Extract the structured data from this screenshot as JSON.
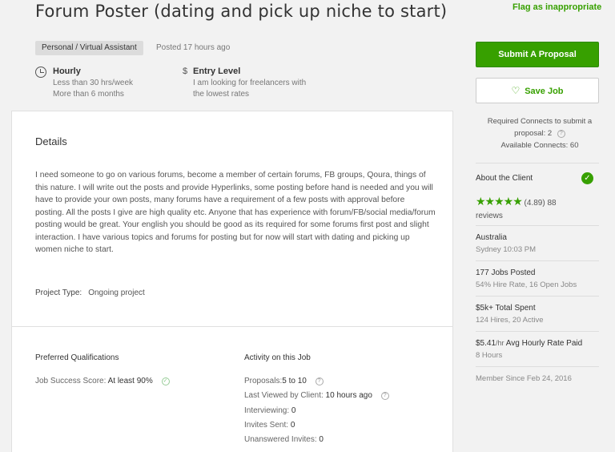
{
  "job": {
    "title": "Forum Poster (dating and pick up niche to start)",
    "flag_label": "Flag as inappropriate",
    "category": "Personal / Virtual Assistant",
    "posted": "Posted 17 hours ago"
  },
  "meta": {
    "hourly": {
      "title": "Hourly",
      "line1": "Less than 30 hrs/week",
      "line2": "More than 6 months",
      "icon": "clock-icon"
    },
    "level": {
      "symbol": "$",
      "title": "Entry Level",
      "line1": "I am looking for freelancers with",
      "line2": "the lowest rates",
      "icon": "dollar-icon"
    }
  },
  "details": {
    "heading": "Details",
    "body": "I need someone to go on various forums, become a member of certain forums, FB groups, Qoura, things of this nature.  I will write out the posts and provide Hyperlinks, some posting before hand is needed and you will have to provide your own posts, many forums have a requirement of a few posts with approval before posting.  All the posts I give are high quality etc.  Anyone that has experience with forum/FB/social media/forum posting would be great.  Your english you should be good as its required for some forums first post and slight interaction.  I have various topics and forums for posting but for now will start with dating and picking up women niche to start.",
    "project_type_label": "Project Type:",
    "project_type_value": "Ongoing project"
  },
  "qualifications": {
    "heading": "Preferred Qualifications",
    "jss_label": "Job Success Score:",
    "jss_value": "At least 90%"
  },
  "activity": {
    "heading": "Activity on this Job",
    "proposals_label": "Proposals:",
    "proposals_value": "5 to 10",
    "viewed_label": "Last Viewed by Client:",
    "viewed_value": "10 hours ago",
    "interviewing_label": "Interviewing:",
    "interviewing_value": "0",
    "invites_label": "Invites Sent:",
    "invites_value": "0",
    "unanswered_label": "Unanswered Invites:",
    "unanswered_value": "0"
  },
  "sidebar": {
    "submit_label": "Submit A Proposal",
    "save_label": "Save Job",
    "connects_required": "Required Connects to submit a proposal: 2",
    "connects_available": "Available Connects: 60"
  },
  "client": {
    "heading": "About the Client",
    "rating": "(4.89) 88",
    "reviews": "reviews",
    "stars": 5,
    "country": "Australia",
    "local_time": "Sydney 10:03 PM",
    "jobs_posted": "177 Jobs Posted",
    "jobs_detail": "54% Hire Rate, 16 Open Jobs",
    "spent": "$5k+ Total Spent",
    "spent_detail": "124 Hires, 20 Active",
    "rate_value": "$5.41",
    "rate_unit": "/hr",
    "rate_label": "Avg Hourly Rate Paid",
    "hours": "8 Hours",
    "member_since": "Member Since Feb 24, 2016"
  },
  "colors": {
    "accent": "#37a000",
    "background": "#f2f2f2"
  }
}
